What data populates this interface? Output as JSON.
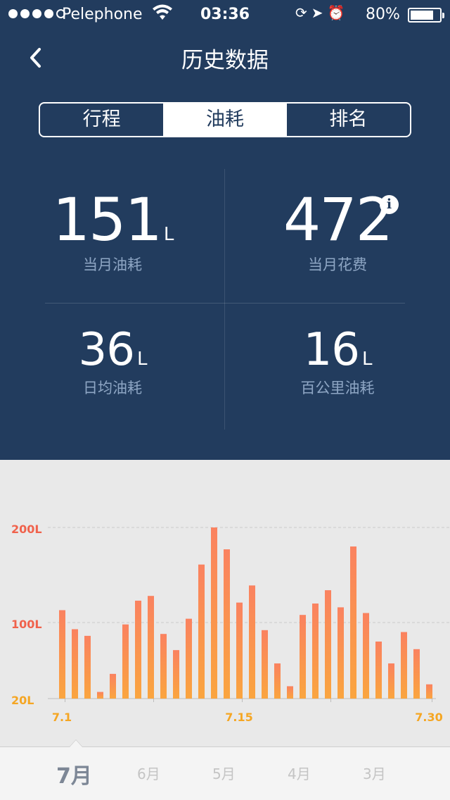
{
  "status_bar": {
    "carrier": "Pelephone",
    "time": "03:36",
    "battery": "80%",
    "battery_level": 0.8,
    "signal_bars": 4,
    "signal_max": 5
  },
  "nav": {
    "title": "历史数据"
  },
  "tabs": [
    {
      "label": "行程",
      "active": false
    },
    {
      "label": "油耗",
      "active": true
    },
    {
      "label": "排名",
      "active": false
    }
  ],
  "stats": {
    "monthly_fuel": {
      "value": "151",
      "unit": "L",
      "label": "当月油耗"
    },
    "monthly_cost": {
      "value": "472",
      "label": "当月花费"
    },
    "daily_avg": {
      "value": "36",
      "unit": "L",
      "label": "日均油耗"
    },
    "per_100km": {
      "value": "16",
      "unit": "L",
      "label": "百公里油耗"
    }
  },
  "icons": {
    "back": "chevron-left-icon",
    "info": "info-icon",
    "info_glyph": "i"
  },
  "colors": {
    "header_bg": "#223c5e",
    "bar_top": "#fa8260",
    "bar_bottom": "#faa53f",
    "axis_label_red": "#f0624c",
    "axis_label_orange": "#f5a623"
  },
  "chart_data": {
    "type": "bar",
    "x": [
      1,
      2,
      3,
      4,
      5,
      6,
      7,
      8,
      9,
      10,
      11,
      12,
      13,
      14,
      15,
      16,
      17,
      18,
      19,
      20,
      21,
      22,
      23,
      24,
      25,
      26,
      27,
      28,
      29,
      30
    ],
    "values": [
      113,
      93,
      86,
      27,
      46,
      98,
      123,
      128,
      88,
      71,
      104,
      161,
      200,
      177,
      121,
      139,
      92,
      57,
      33,
      108,
      120,
      134,
      116,
      180,
      110,
      80,
      57,
      90,
      72,
      35
    ],
    "y_ticks": [
      "200L",
      "100L",
      "20L"
    ],
    "x_ticks": [
      "7.1",
      "7.15",
      "7.30"
    ],
    "grid": true
  },
  "months": [
    {
      "label": "7月",
      "active": true
    },
    {
      "label": "6月",
      "active": false
    },
    {
      "label": "5月",
      "active": false
    },
    {
      "label": "4月",
      "active": false
    },
    {
      "label": "3月",
      "active": false
    }
  ]
}
